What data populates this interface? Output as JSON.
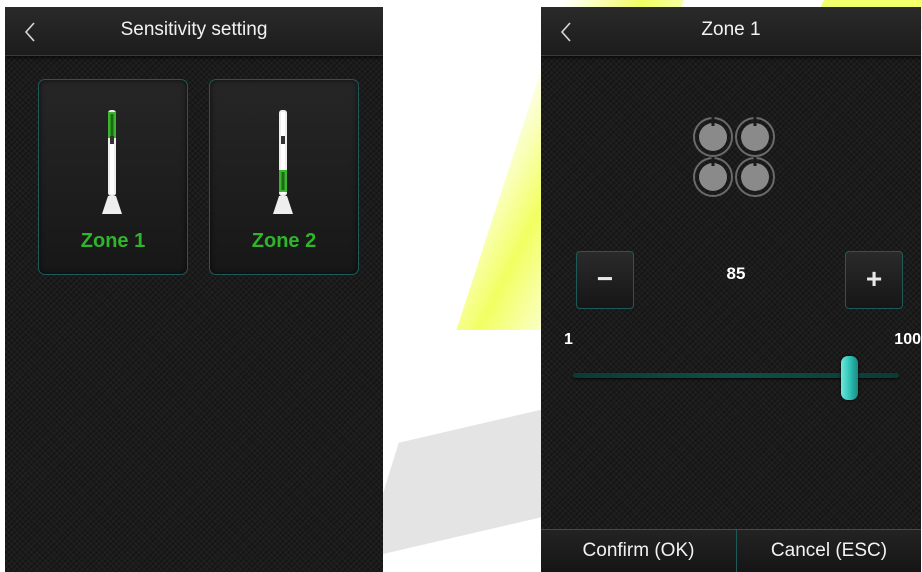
{
  "left_screen": {
    "title": "Sensitivity setting",
    "zones": [
      {
        "label": "Zone 1",
        "icon": "sensor-icon",
        "indicator_position": "top"
      },
      {
        "label": "Zone 2",
        "icon": "sensor-icon",
        "indicator_position": "middle"
      }
    ]
  },
  "right_screen": {
    "title": "Zone 1",
    "sensor_icon": "sensor-cluster-icon",
    "stepper": {
      "minus": "−",
      "plus": "+",
      "value": "85"
    },
    "slider": {
      "min_label": "1",
      "max_label": "100",
      "min": 1,
      "max": 100,
      "value": 85
    },
    "buttons": {
      "confirm": "Confirm (OK)",
      "cancel": "Cancel (ESC)"
    }
  },
  "colors": {
    "accent_green": "#2fb52b",
    "slider_thumb": "#2bbfb3",
    "border_teal": "#1f5a5a",
    "background": "#1b1b1b"
  }
}
